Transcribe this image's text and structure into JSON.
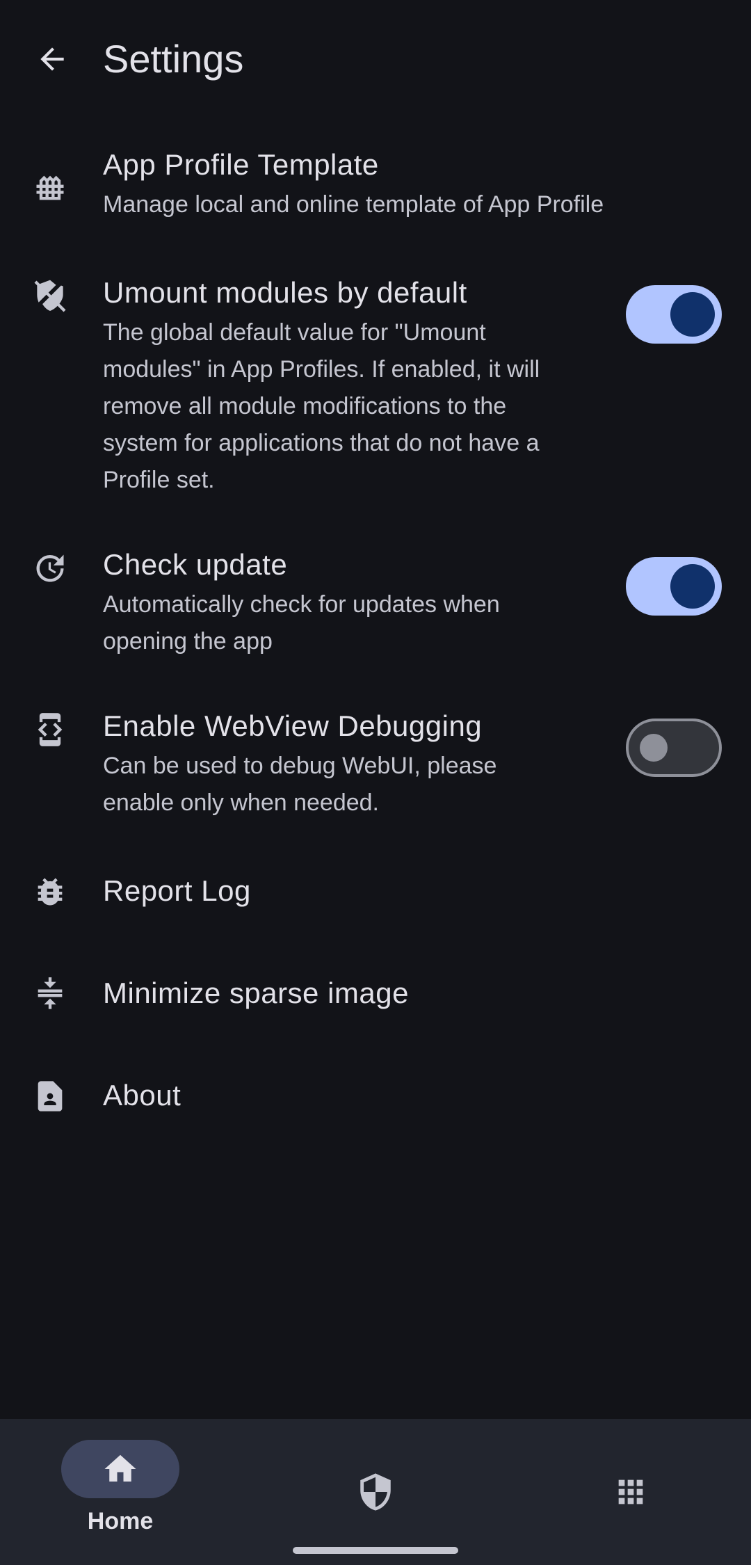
{
  "header": {
    "title": "Settings",
    "back_icon": "arrow-back-icon"
  },
  "settings": [
    {
      "id": "app-profile-template",
      "icon": "fence-icon",
      "title": "App Profile Template",
      "subtitle": "Manage local and online template of App Profile"
    },
    {
      "id": "umount-modules",
      "icon": "shield-off-icon",
      "title": "Umount modules by default",
      "subtitle_lines": [
        "The global default value for \"Umount",
        "modules\" in App Profiles. If enabled, it will",
        "remove all module modifications to the",
        "system for applications that do not have a",
        "Profile set."
      ],
      "switch_on": true
    },
    {
      "id": "check-update",
      "icon": "update-icon",
      "title": "Check update",
      "subtitle_lines": [
        "Automatically check for updates when",
        "opening the app"
      ],
      "switch_on": true
    },
    {
      "id": "webview-debugging",
      "icon": "developer-mode-icon",
      "title": "Enable WebView Debugging",
      "subtitle_lines": [
        "Can be used to debug WebUI, please",
        "enable only when needed."
      ],
      "switch_on": false
    },
    {
      "id": "report-log",
      "icon": "bug-icon",
      "title": "Report Log"
    },
    {
      "id": "minimize-sparse-image",
      "icon": "compress-icon",
      "title": "Minimize sparse image"
    },
    {
      "id": "about",
      "icon": "contact-page-icon",
      "title": "About"
    }
  ],
  "nav": [
    {
      "label": "Home",
      "icon": "home-icon",
      "selected": true
    },
    {
      "label": "",
      "icon": "shield-icon",
      "selected": false
    },
    {
      "label": "",
      "icon": "apps-grid-icon",
      "selected": false
    }
  ],
  "colors": {
    "background": "#121318",
    "text_primary": "#e3e2e9",
    "text_secondary": "#c5c6d0",
    "switch_on_track": "#b1c5ff",
    "switch_on_thumb": "#10316b",
    "switch_off_outline": "#8e9099",
    "nav_background": "#22252e",
    "nav_indicator": "#3f4660"
  }
}
